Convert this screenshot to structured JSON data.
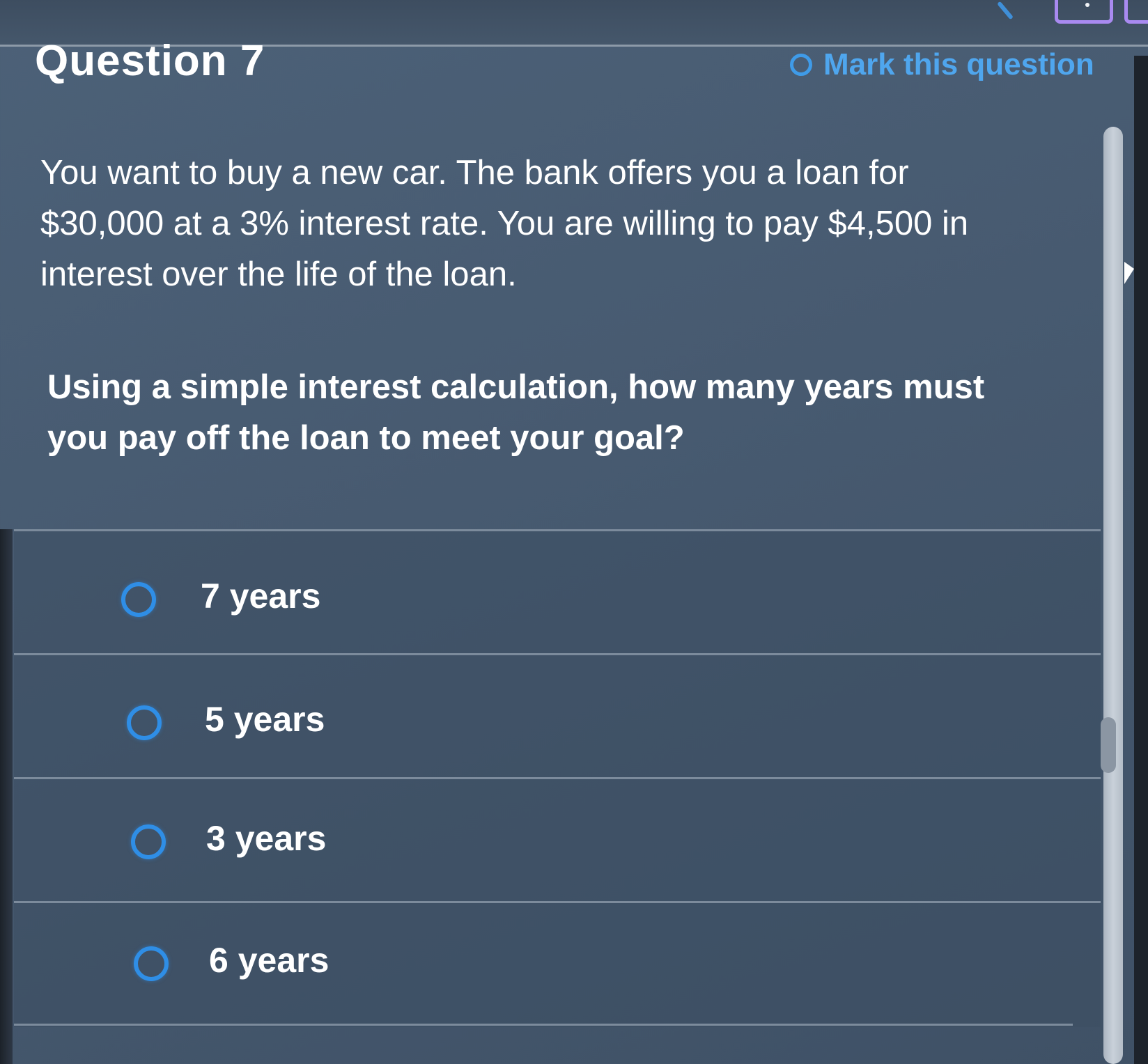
{
  "header": {
    "title": "Question 7",
    "mark_label": "Mark this question"
  },
  "question": {
    "stem": "You want to buy a new car. The bank offers you a loan for $30,000 at a 3% interest rate. You are willing to pay $4,500 in interest over the life of the loan.",
    "prompt": "Using a simple interest calculation, how many years must you pay off the loan to meet your goal?"
  },
  "answers": [
    {
      "label": "7 years"
    },
    {
      "label": "5 years"
    },
    {
      "label": "3 years"
    },
    {
      "label": "6 years"
    }
  ],
  "colors": {
    "accent": "#3f9be8",
    "background": "#4c6178",
    "text": "#ffffff"
  }
}
